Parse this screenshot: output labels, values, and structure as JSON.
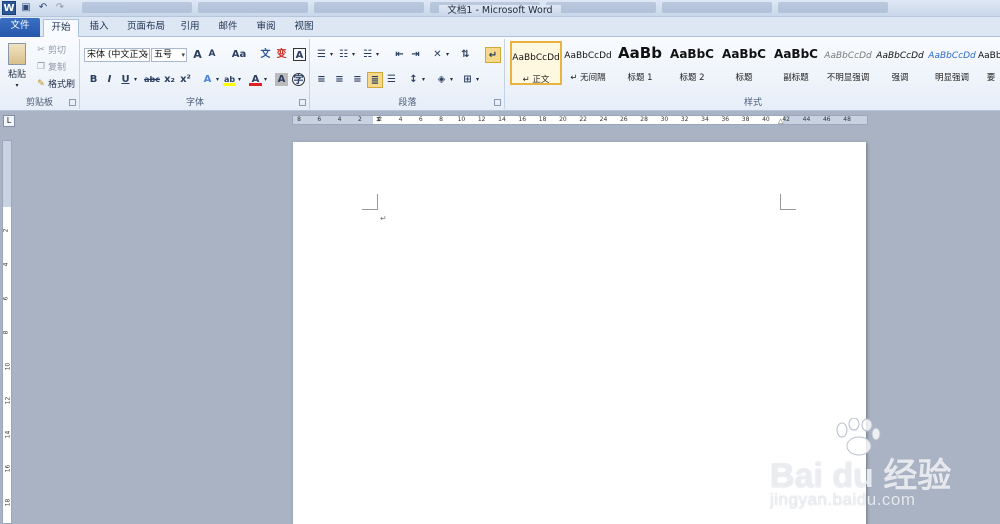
{
  "window": {
    "title": "文档1 - Microsoft Word"
  },
  "quick_access": {
    "logo": "W",
    "save": "💾",
    "undo": "↶",
    "redo": "↷"
  },
  "tabs": [
    {
      "label": "文件"
    },
    {
      "label": "开始"
    },
    {
      "label": "插入"
    },
    {
      "label": "页面布局"
    },
    {
      "label": "引用"
    },
    {
      "label": "邮件"
    },
    {
      "label": "审阅"
    },
    {
      "label": "视图"
    }
  ],
  "clipboard": {
    "label": "剪贴板",
    "paste": "粘贴",
    "cut": "剪切",
    "copy": "复制",
    "format_painter": "格式刷"
  },
  "font": {
    "label": "字体",
    "font_name": "宋体 (中文正文",
    "font_size": "五号",
    "grow": "A",
    "shrink": "A",
    "change_case": "Aa",
    "clear_format": "A",
    "bold": "B",
    "italic": "I",
    "underline": "U",
    "strike": "abc",
    "subscript": "x₂",
    "superscript": "x²",
    "text_effect": "A",
    "highlight": "ab",
    "font_color": "A",
    "char_shading": "A"
  },
  "paragraph": {
    "label": "段落"
  },
  "styles": {
    "label": "样式",
    "items": [
      {
        "sample": "AaBbCcDd",
        "name": "↵ 正文"
      },
      {
        "sample": "AaBbCcDd",
        "name": "↵ 无间隔"
      },
      {
        "sample": "AaBb",
        "name": "标题 1"
      },
      {
        "sample": "AaBbC",
        "name": "标题 2"
      },
      {
        "sample": "AaBbC",
        "name": "标题"
      },
      {
        "sample": "AaBbC",
        "name": "副标题"
      },
      {
        "sample": "AaBbCcDd",
        "name": "不明显强调"
      },
      {
        "sample": "AaBbCcDd",
        "name": "强调"
      },
      {
        "sample": "AaBbCcDd",
        "name": "明显强调"
      },
      {
        "sample": "AaBbCcDd",
        "name": "要"
      }
    ]
  },
  "ruler": {
    "h_ticks": [
      "8",
      "6",
      "4",
      "2",
      "2",
      "4",
      "6",
      "8",
      "10",
      "12",
      "14",
      "16",
      "18",
      "20",
      "22",
      "24",
      "26",
      "28",
      "30",
      "32",
      "34",
      "36",
      "38",
      "40",
      "42",
      "44",
      "46",
      "48"
    ],
    "v_ticks": [
      "2",
      "4",
      "6",
      "8",
      "10",
      "12",
      "14",
      "16",
      "18",
      "20"
    ],
    "corner": "L"
  },
  "document": {
    "para_mark": "↵"
  },
  "watermark": {
    "main": "Bai du 经验",
    "sub": "jingyan.baidu.com"
  },
  "colors": {
    "accent": "#2b5797",
    "highlight_yellow": "#ffff00",
    "font_red": "#e02020"
  }
}
